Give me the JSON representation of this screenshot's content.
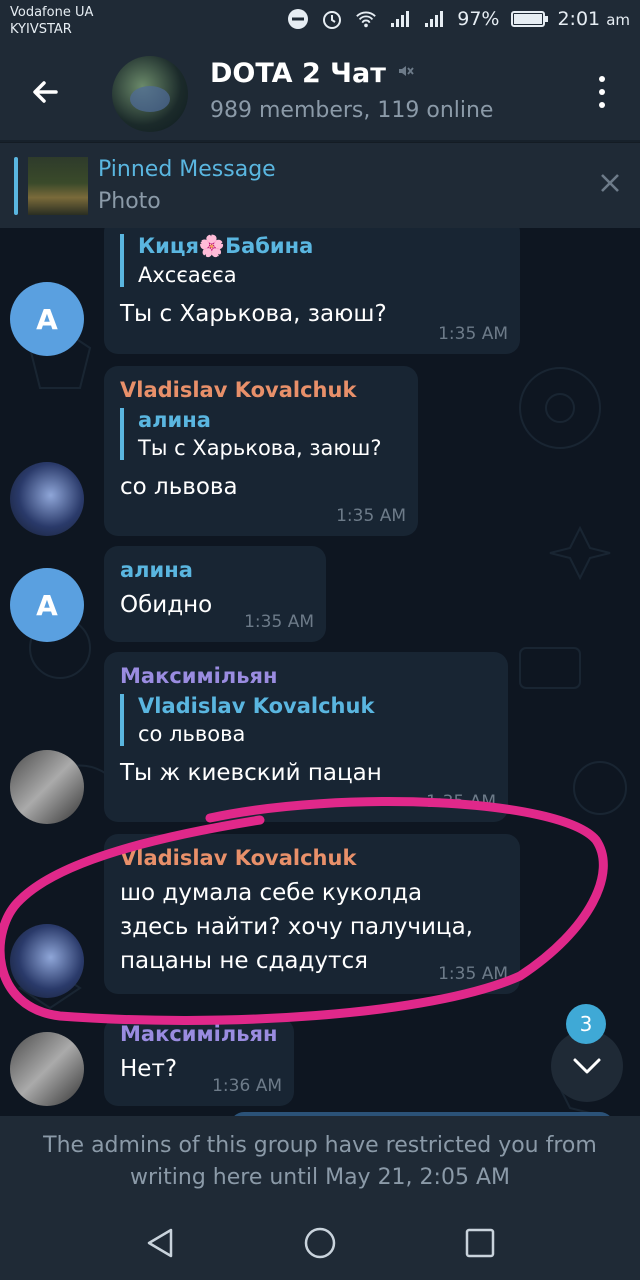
{
  "status_bar": {
    "carrier_line1": "Vodafone UA",
    "carrier_line2": "KYIVSTAR",
    "battery": "97%",
    "battery_level": 0.97,
    "time": "2:01",
    "ampm": "am"
  },
  "header": {
    "title": "DOTA 2 Чат",
    "subtitle": "989 members, 119 online"
  },
  "pinned": {
    "title": "Pinned Message",
    "subtitle": "Photo"
  },
  "messages": [
    {
      "reply_name": "Киця🌸Бабина",
      "reply_text": "Ахсєаєєа",
      "text": "Ты с Харькова, заюш?",
      "time": "1:35 AM",
      "avatar_letter": "A"
    },
    {
      "sender": "Vladislav Kovalchuk",
      "sender_color": "#e8906a",
      "reply_name": "алина",
      "reply_text": "Ты с Харькова, заюш?",
      "text": "со львова",
      "time": "1:35 AM"
    },
    {
      "sender": "алина",
      "sender_color": "#5ab6e0",
      "text": "Обидно",
      "time": "1:35 AM",
      "avatar_letter": "A"
    },
    {
      "sender": "Максимільян",
      "sender_color": "#9a8ce0",
      "reply_name": "Vladislav Kovalchuk",
      "reply_text": "со львова",
      "text": "Ты ж киевский пацан",
      "time": "1:35 AM"
    },
    {
      "sender": "Vladislav Kovalchuk",
      "sender_color": "#e8906a",
      "text_line1": "шо думала себе куколда",
      "text_line2": "здесь найти? хочу палучица,",
      "text_line3": "пацаны не сдадутся",
      "time": "1:35 AM"
    },
    {
      "sender": "Максимільян",
      "sender_color": "#9a8ce0",
      "text": "Нет?",
      "time": "1:36 AM"
    }
  ],
  "scroll_fab": {
    "badge": "3"
  },
  "restricted": {
    "line1": "The admins of this group have restricted you from",
    "line2": "writing here until May 21, 2:05 AM"
  },
  "colors": {
    "accent": "#5ab6e0",
    "annotation": "#e0288a"
  }
}
